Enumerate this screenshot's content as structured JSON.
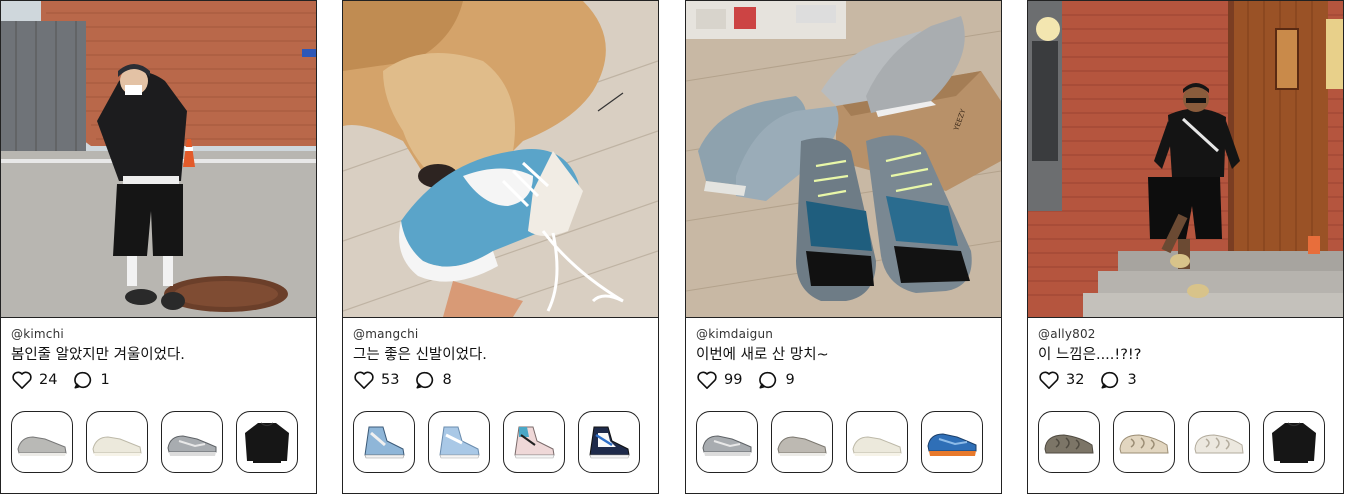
{
  "posts": [
    {
      "username": "@kimchi",
      "caption": "봄인줄 알았지만 겨울이었다.",
      "likes": "24",
      "comments": "1",
      "photo_icon": "person-street-outfit-photo",
      "products": [
        "grey-sneaker-icon",
        "cream-sneaker-icon",
        "grey-runner-icon",
        "black-sweatshirt-icon"
      ]
    },
    {
      "username": "@mangchi",
      "caption": "그는 좋은 신발이었다.",
      "likes": "53",
      "comments": "8",
      "photo_icon": "dog-with-sneaker-photo",
      "products": [
        "blue-high-top-icon",
        "light-blue-high-top-icon",
        "pink-high-top-icon",
        "navy-high-top-icon"
      ]
    },
    {
      "username": "@kimdaigun",
      "caption": "이번에 새로 산 망치~",
      "likes": "99",
      "comments": "9",
      "photo_icon": "sneaker-collection-photo",
      "products": [
        "grey-runner-icon",
        "grey-sneaker-icon",
        "cream-sneaker-icon",
        "blue-orange-runner-icon"
      ]
    },
    {
      "username": "@ally802",
      "caption": "이 느낌은....!?!?",
      "likes": "32",
      "comments": "3",
      "photo_icon": "man-brick-wall-photo",
      "products": [
        "olive-foam-runner-icon",
        "beige-foam-runner-icon",
        "white-foam-runner-icon",
        "black-sweatshirt-icon"
      ]
    }
  ],
  "colors": {
    "border": "#222222",
    "text": "#111111"
  }
}
